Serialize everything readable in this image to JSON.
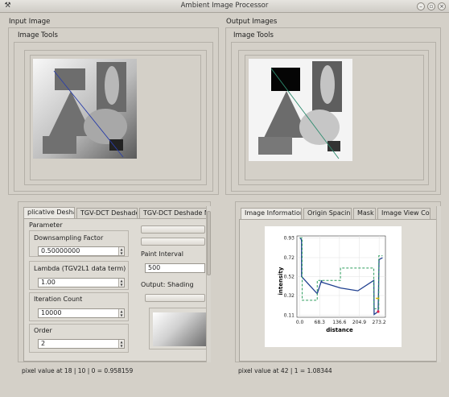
{
  "window": {
    "title": "Ambient Image Processor"
  },
  "left": {
    "title": "Input Image",
    "menu": [
      "Image",
      "Tools"
    ],
    "tabs": [
      "plicative Deshade",
      "TGV-DCT Deshade",
      "TGV-DCT Deshade Ma"
    ],
    "parameter_title": "Parameter",
    "fields": [
      {
        "label": "Downsampling Factor",
        "value": "0.50000000"
      },
      {
        "label": "Lambda (TGV2L1 data term)",
        "value": "1.00"
      },
      {
        "label": "Iteration Count",
        "value": "10000"
      },
      {
        "label": "Order",
        "value": "2"
      }
    ],
    "paint_interval_label": "Paint Interval",
    "paint_interval_value": "500",
    "output_label": "Output: Shading",
    "status": "pixel value at 18 | 10 | 0 = 0.958159"
  },
  "right": {
    "title": "Output Images",
    "menu": [
      "Image",
      "Tools"
    ],
    "tabs": [
      "Image Information",
      "Origin Spacing",
      "Mask",
      "Image View Co"
    ],
    "status": "pixel value at 42 | 1 = 1.08344"
  },
  "chart_data": {
    "type": "line",
    "xlabel": "distance",
    "ylabel": "intensity",
    "xticks": [
      "0.0",
      "68.3",
      "136.6",
      "204.9",
      "273.2"
    ],
    "yticks": [
      "0.93",
      "0.72",
      "0.52",
      "0.32",
      "0.11"
    ],
    "xlim": [
      -10,
      295
    ],
    "ylim": [
      0.09,
      0.95
    ],
    "series": [
      {
        "color": "#1f3f8f",
        "x": [
          0,
          4,
          6,
          6.1,
          60,
          75,
          76,
          140,
          200,
          255,
          256,
          270,
          273,
          285
        ],
        "y": [
          0.93,
          0.92,
          0.9,
          0.52,
          0.34,
          0.48,
          0.46,
          0.4,
          0.37,
          0.48,
          0.12,
          0.15,
          0.7,
          0.72
        ]
      },
      {
        "color": "#2e9e5e",
        "style": "dashed",
        "x": [
          0,
          8,
          8.1,
          60,
          60.1,
          140,
          140.1,
          255,
          255.1,
          272,
          272.1,
          285
        ],
        "y": [
          0.93,
          0.93,
          0.27,
          0.27,
          0.48,
          0.48,
          0.61,
          0.61,
          0.18,
          0.18,
          0.74,
          0.74
        ]
      }
    ]
  }
}
